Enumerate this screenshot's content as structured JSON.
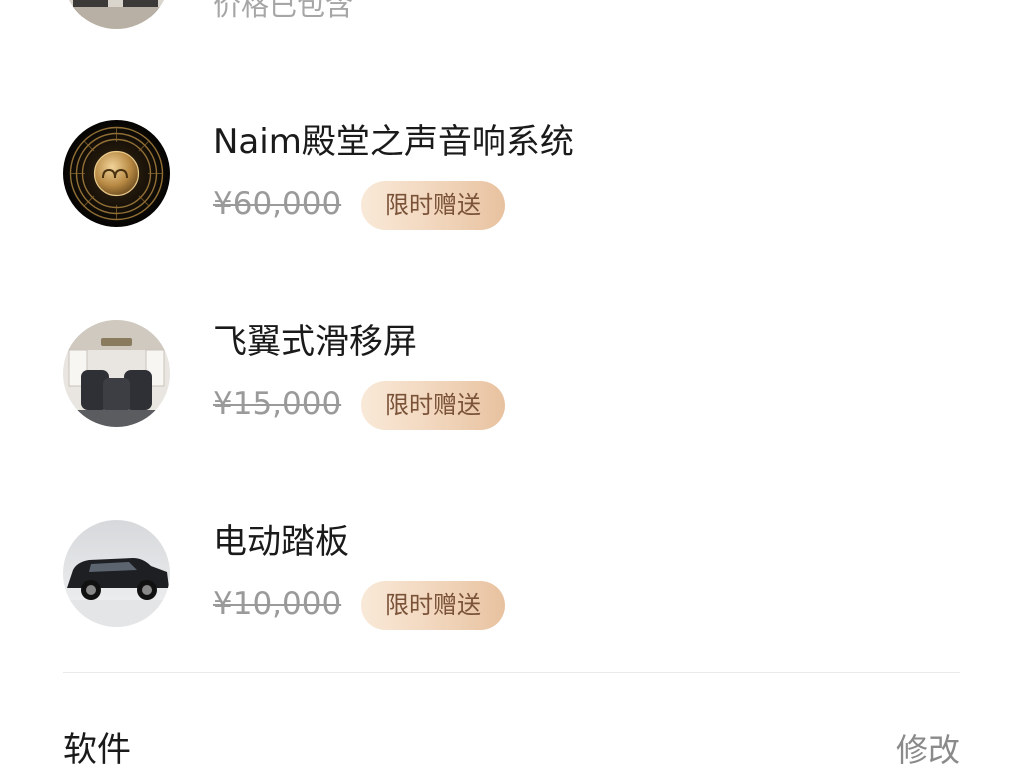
{
  "top_item": {
    "caption": "价格已包含",
    "icon": "seat-interior-thumbnail"
  },
  "options": [
    {
      "title": "Naim殿堂之声音响系统",
      "price": "¥60,000",
      "badge": "限时赠送",
      "icon": "naim-speaker-thumbnail"
    },
    {
      "title": "飞翼式滑移屏",
      "price": "¥15,000",
      "badge": "限时赠送",
      "icon": "cabin-screen-thumbnail"
    },
    {
      "title": "电动踏板",
      "price": "¥10,000",
      "badge": "限时赠送",
      "icon": "suv-side-thumbnail"
    }
  ],
  "software_section": {
    "title": "软件",
    "edit_label": "修改"
  },
  "colors": {
    "badge_text": "#7a5238",
    "badge_gradient_start": "#f9e9d8",
    "badge_gradient_end": "#e8c2a0",
    "strike_price": "#9a9a9a"
  }
}
